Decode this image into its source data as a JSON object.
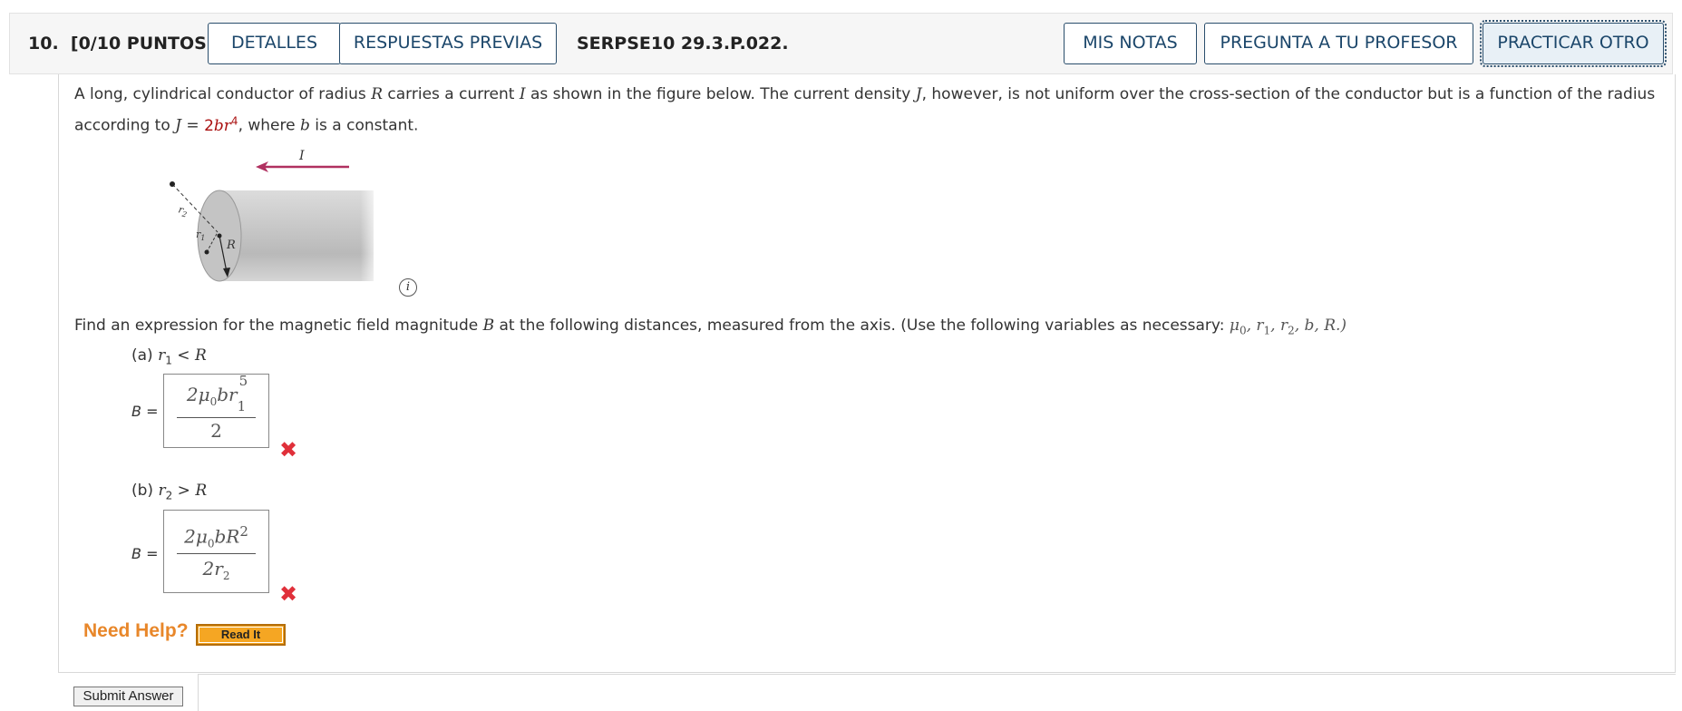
{
  "header": {
    "question_number": "10.",
    "points": "[0/10 PUNTOS]",
    "details_button": "DETALLES",
    "previous_answers_button": "RESPUESTAS PREVIAS",
    "problem_code": "SERPSE10 29.3.P.022.",
    "my_notes_button": "MIS NOTAS",
    "ask_teacher_button": "PREGUNTA A TU PROFESOR",
    "practice_another_button": "PRACTICAR OTRO"
  },
  "problem": {
    "intro_1": "A long, cylindrical conductor of radius",
    "var_R": "R",
    "intro_2": "carries a current",
    "var_I": "I",
    "intro_3": "as shown in the figure below. The current density",
    "var_J": "J",
    "intro_4": ", however, is not uniform over the cross-section of the conductor but is a function of the radius according to",
    "var_J2": "J",
    "equals": "=",
    "formula_coef": "2",
    "formula_b": "b",
    "formula_r": "r",
    "formula_exp": "4",
    "intro_5": ", where",
    "var_b": "b",
    "intro_6": "is a constant.",
    "figure": {
      "current_label": "I",
      "r2_label": "r2",
      "r1_label": "r1",
      "R_label": "R",
      "cylinder_color": "#c8c8c8",
      "arrow_color": "#b03060"
    },
    "info_icon": "i",
    "find_1": "Find an expression for the magnetic field magnitude",
    "var_B": "B",
    "find_2": "at the following distances, measured from the axis. (Use the following variables as necessary:",
    "vars_list": "μ0, r1, r2, b, R.)"
  },
  "part_a": {
    "label": "(a) r1 < R",
    "b_label": "B =",
    "numerator": "2μ0br1^5",
    "denominator": "2",
    "status": "incorrect"
  },
  "part_b": {
    "label": "(b) r2 > R",
    "b_label": "B =",
    "numerator": "2μ0bR^2",
    "denominator": "2r2",
    "status": "incorrect"
  },
  "help": {
    "need_help": "Need Help?",
    "read_it": "Read It"
  },
  "submit_button": "Submit Answer"
}
